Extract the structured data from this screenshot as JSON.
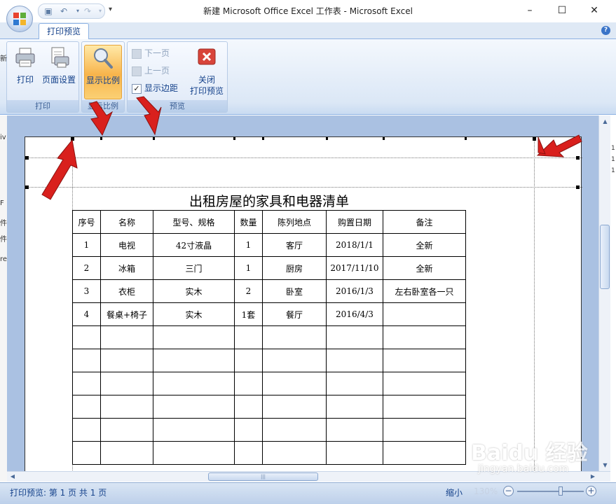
{
  "window": {
    "title": "新建 Microsoft Office Excel 工作表 - Microsoft Excel",
    "minimize": "–",
    "maximize": "☐",
    "close": "✕"
  },
  "qat": {
    "save": "▣",
    "undo": "↶",
    "redo": "↷",
    "more": "▾"
  },
  "ribbon": {
    "tab": "打印预览",
    "help": "?",
    "groups": {
      "print": {
        "label": "打印",
        "print_btn": "打印",
        "page_setup_btn": "页面设置"
      },
      "zoom": {
        "label": "显示比例",
        "zoom_btn": "显示比例"
      },
      "preview": {
        "label": "预览",
        "next_page": "下一页",
        "prev_page": "上一页",
        "show_margins": "显示边距",
        "show_margins_checked": true,
        "close_line1": "关闭",
        "close_line2": "打印预览"
      }
    }
  },
  "sheet": {
    "title": "出租房屋的家具和电器清单",
    "headers": [
      "序号",
      "名称",
      "型号、规格",
      "数量",
      "陈列地点",
      "购置日期",
      "备注"
    ],
    "rows": [
      [
        "1",
        "电视",
        "42寸液晶",
        "1",
        "客厅",
        "2018/1/1",
        "全新"
      ],
      [
        "2",
        "冰箱",
        "三门",
        "1",
        "厨房",
        "2017/11/10",
        "全新"
      ],
      [
        "3",
        "衣柜",
        "实木",
        "2",
        "卧室",
        "2016/1/3",
        "左右卧室各一只"
      ],
      [
        "4",
        "餐桌+椅子",
        "实木",
        "1套",
        "餐厅",
        "2016/4/3",
        ""
      ]
    ],
    "empty_rows": 6
  },
  "left_strip_chars": [
    "新",
    "iv",
    "F",
    "件",
    "件",
    "re"
  ],
  "right_strip_chars": [
    "1",
    "1",
    "1"
  ],
  "status": {
    "text": "打印预览: 第 1 页 共 1 页",
    "zoom_out_label": "缩小",
    "zoom_level": "130%",
    "zoom_minus": "−",
    "zoom_plus": "+"
  },
  "hscroll_grip": "|||",
  "watermark": {
    "main": "Baidu 经验",
    "sub": "jingyan.baidu.com"
  },
  "colors": {
    "ribbon_accent": "#15428b",
    "workspace_bg": "#aac1e2",
    "zoom_active": "#f7b44b",
    "arrow_red": "#d9201d"
  }
}
